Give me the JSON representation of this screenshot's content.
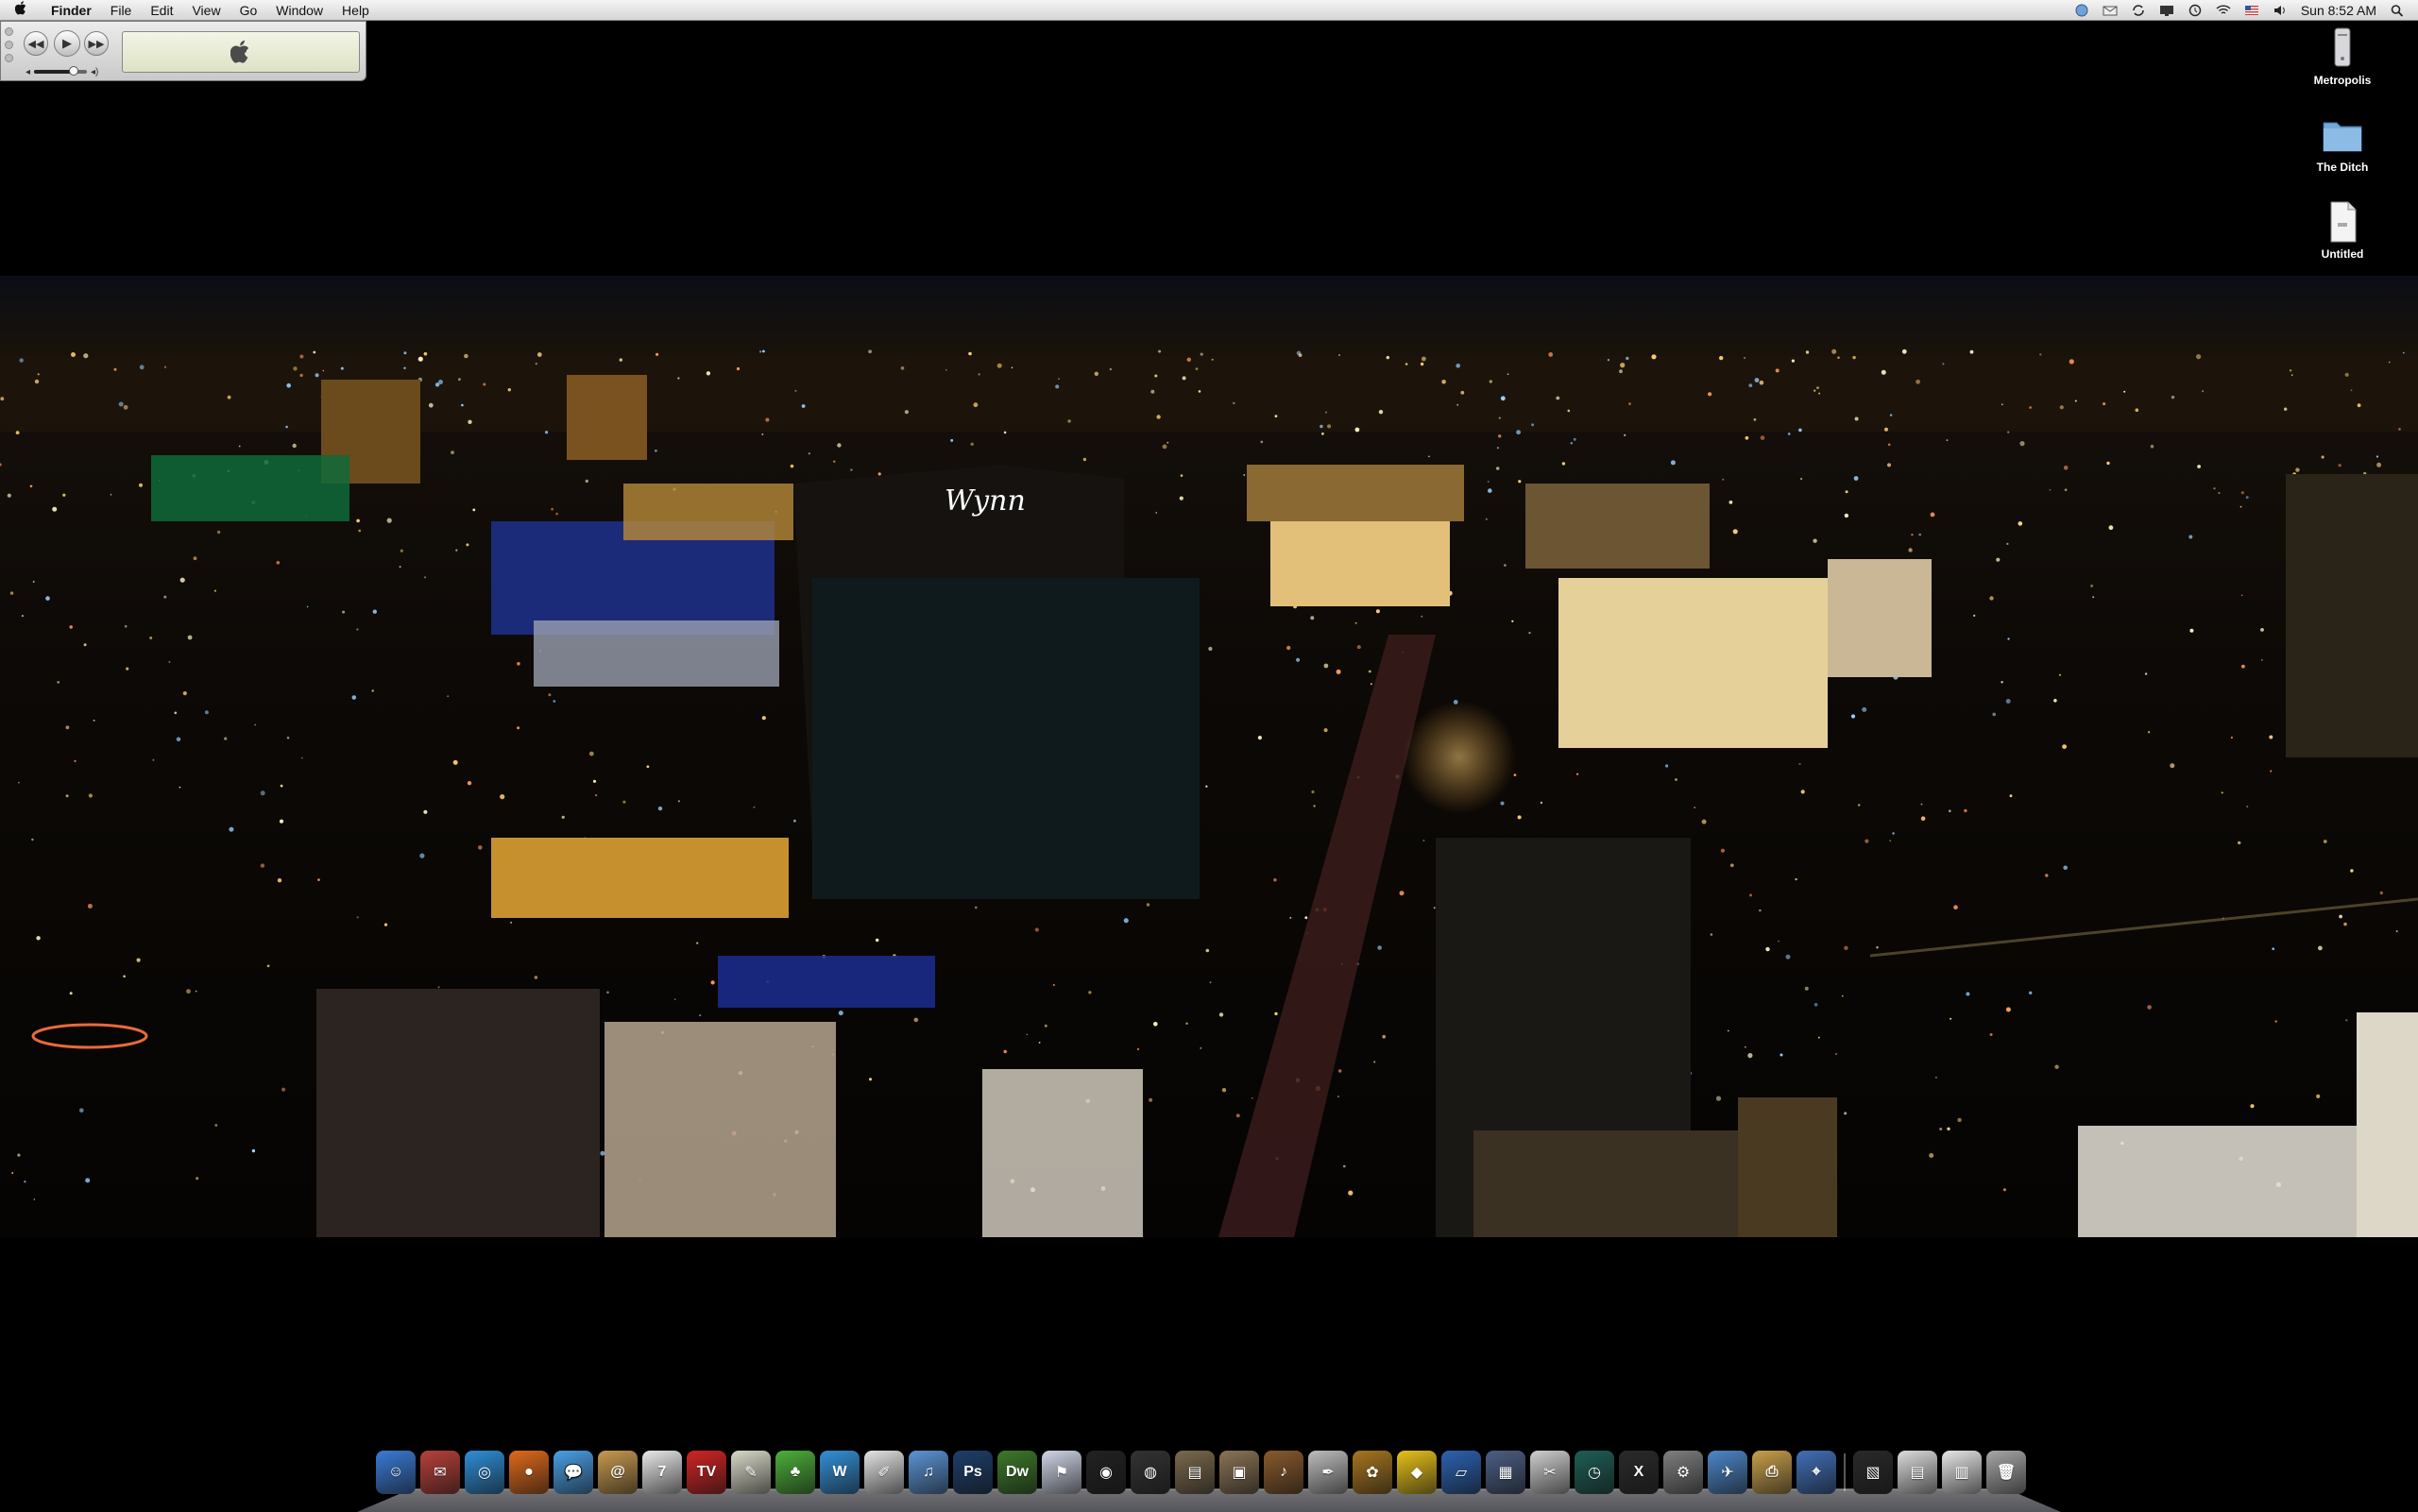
{
  "menubar": {
    "apple": "",
    "items": [
      {
        "label": "Finder",
        "name": "menu-finder",
        "bold": true
      },
      {
        "label": "File",
        "name": "menu-file"
      },
      {
        "label": "Edit",
        "name": "menu-edit"
      },
      {
        "label": "View",
        "name": "menu-view"
      },
      {
        "label": "Go",
        "name": "menu-go"
      },
      {
        "label": "Window",
        "name": "menu-window"
      },
      {
        "label": "Help",
        "name": "menu-help"
      }
    ],
    "status_icons": [
      "globe-icon",
      "mail-icon",
      "sync-icon",
      "display-icon",
      "time-machine-icon",
      "wifi-icon",
      "us-flag-icon",
      "volume-icon"
    ],
    "clock": "Sun 8:52 AM",
    "spotlight_icon": "spotlight-icon"
  },
  "miniplayer": {
    "prev_glyph": "◀◀",
    "play_glyph": "▶",
    "next_glyph": "▶▶",
    "volume_level": 0.75,
    "display_icon": "apple-logo-icon"
  },
  "desktop_icons": [
    {
      "label": "Metropolis",
      "icon": "hard-drive-icon"
    },
    {
      "label": "The Ditch",
      "icon": "folder-icon"
    },
    {
      "label": "Untitled",
      "icon": "document-icon"
    }
  ],
  "dock": {
    "items": [
      {
        "icon": "finder-icon",
        "color": "#3b7bd6",
        "glyph": "☺"
      },
      {
        "icon": "mail-stamp-icon",
        "color": "#b9413a",
        "glyph": "✉"
      },
      {
        "icon": "safari-icon",
        "color": "#2f8fd8",
        "glyph": "◎"
      },
      {
        "icon": "firefox-icon",
        "color": "#e06a1b",
        "glyph": "●"
      },
      {
        "icon": "ichat-icon",
        "color": "#4aa0e6",
        "glyph": "💬"
      },
      {
        "icon": "address-book-icon",
        "color": "#c79a4f",
        "glyph": "@"
      },
      {
        "icon": "ical-icon",
        "color": "#e9e9e9",
        "glyph": "7"
      },
      {
        "icon": "tv-icon",
        "color": "#d12424",
        "glyph": "TV"
      },
      {
        "icon": "preview-icon",
        "color": "#d9d9c9",
        "glyph": "✎"
      },
      {
        "icon": "dashcode-icon",
        "color": "#4cb03a",
        "glyph": "♣"
      },
      {
        "icon": "wave-icon",
        "color": "#3490d8",
        "glyph": "W"
      },
      {
        "icon": "textedit-icon",
        "color": "#e4e4e4",
        "glyph": "✐"
      },
      {
        "icon": "itunes-icon",
        "color": "#5c95d6",
        "glyph": "♫"
      },
      {
        "icon": "photoshop-icon",
        "color": "#1d3f6b",
        "glyph": "Ps"
      },
      {
        "icon": "dreamweaver-icon",
        "color": "#3c7a2a",
        "glyph": "Dw"
      },
      {
        "icon": "flag-app-icon",
        "color": "#cfd6e6",
        "glyph": "⚑"
      },
      {
        "icon": "aperture-icon",
        "color": "#222222",
        "glyph": "◉"
      },
      {
        "icon": "color-sync-icon",
        "color": "#333333",
        "glyph": "◍"
      },
      {
        "icon": "film-icon",
        "color": "#7b6a4e",
        "glyph": "▤"
      },
      {
        "icon": "iphoto-icon",
        "color": "#8a7455",
        "glyph": "▣"
      },
      {
        "icon": "garageband-icon",
        "color": "#8a5a2c",
        "glyph": "♪"
      },
      {
        "icon": "quill-icon",
        "color": "#bdbdbd",
        "glyph": "✒"
      },
      {
        "icon": "pineapple-icon",
        "color": "#a7761f",
        "glyph": "✿"
      },
      {
        "icon": "adium-duck-icon",
        "color": "#e9c21a",
        "glyph": "◆"
      },
      {
        "icon": "keynote-icon",
        "color": "#2c62b2",
        "glyph": "▱"
      },
      {
        "icon": "spaces-icon",
        "color": "#4b5f85",
        "glyph": "▦"
      },
      {
        "icon": "script-editor-icon",
        "color": "#cfcfcf",
        "glyph": "✂"
      },
      {
        "icon": "time-machine-icon",
        "color": "#1e5f55",
        "glyph": "◷"
      },
      {
        "icon": "x11-icon",
        "color": "#2b2b2b",
        "glyph": "X"
      },
      {
        "icon": "system-preferences-icon",
        "color": "#7f7f7f",
        "glyph": "⚙"
      },
      {
        "icon": "network-utility-icon",
        "color": "#4d87c9",
        "glyph": "✈"
      },
      {
        "icon": "image-capture-icon",
        "color": "#c9a04b",
        "glyph": "⎙"
      },
      {
        "icon": "screenshot-icon",
        "color": "#4170b8",
        "glyph": "⌖"
      },
      {
        "icon": "separator",
        "color": "",
        "glyph": ""
      },
      {
        "icon": "photo-stack-icon",
        "color": "#2a2a2a",
        "glyph": "▧"
      },
      {
        "icon": "documents-stack-icon",
        "color": "#dcdcdc",
        "glyph": "▤"
      },
      {
        "icon": "downloads-stack-icon",
        "color": "#e7e7e7",
        "glyph": "▥"
      },
      {
        "icon": "trash-icon",
        "color": "#a7a7a7",
        "glyph": "🗑"
      }
    ]
  }
}
